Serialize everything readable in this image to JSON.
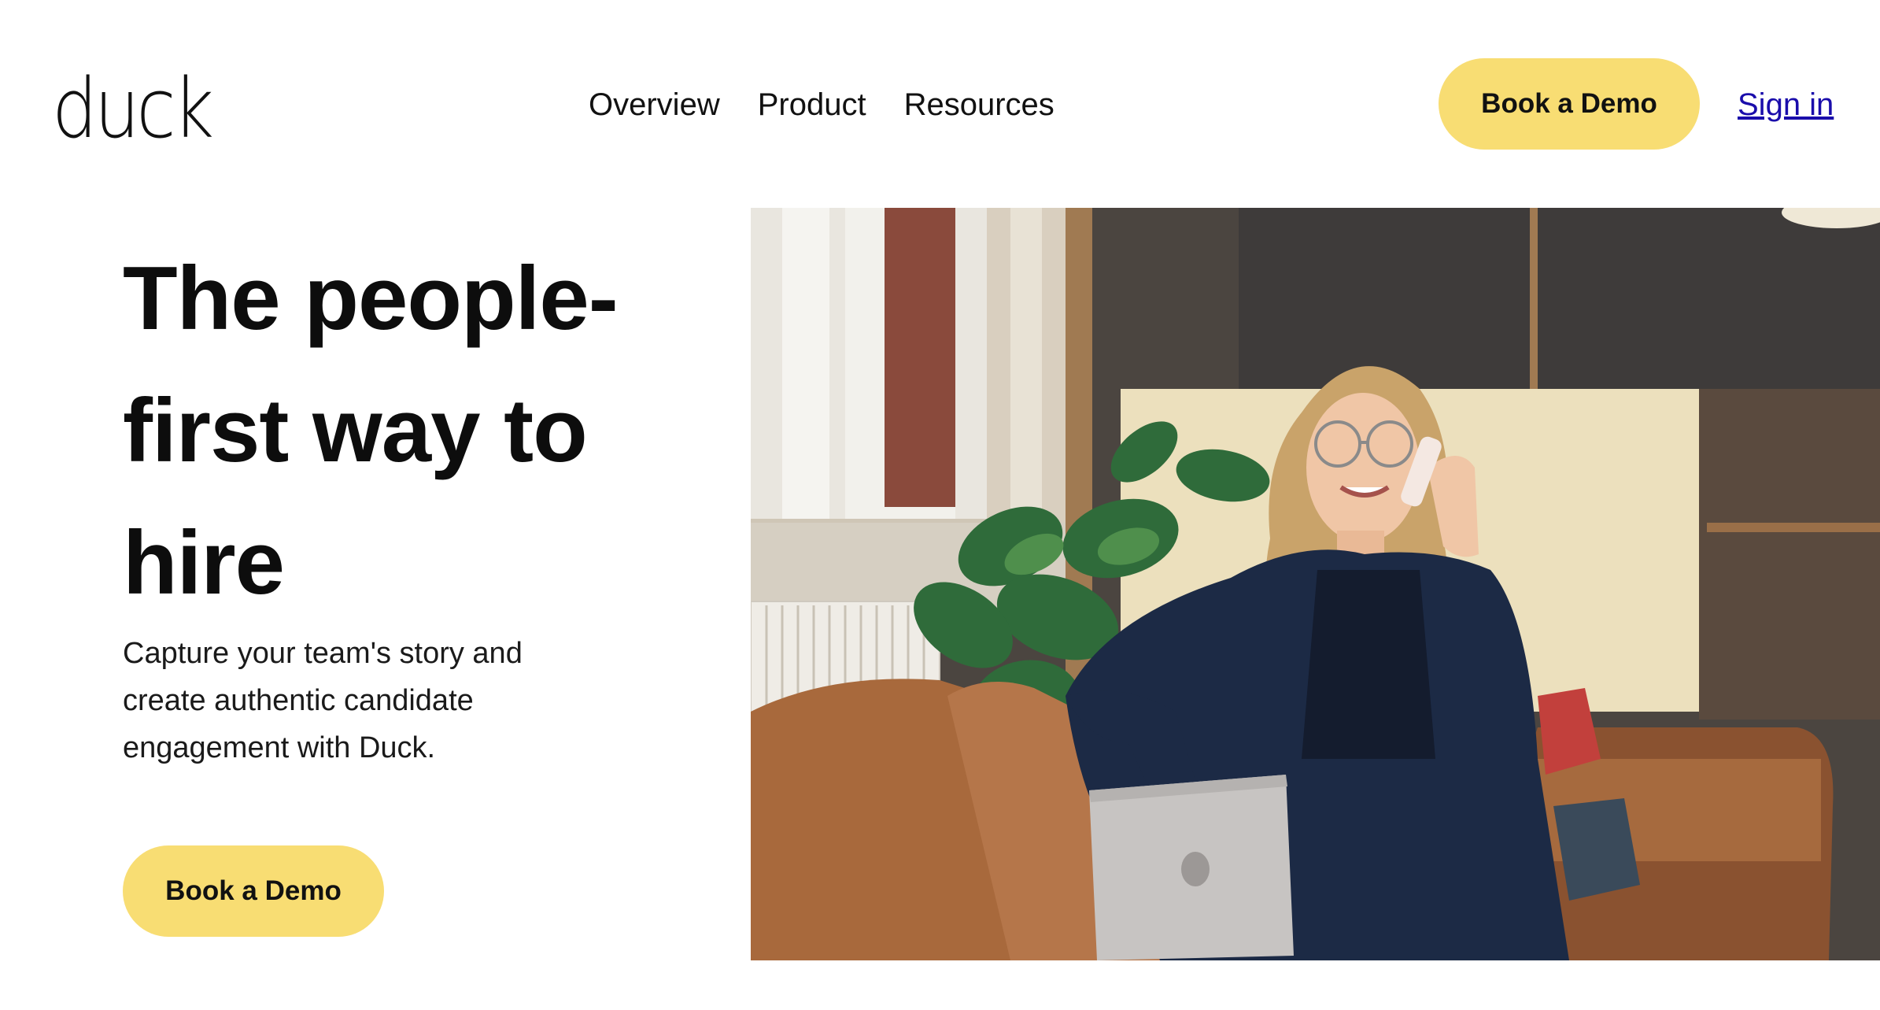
{
  "header": {
    "logo_text": "duck",
    "nav": [
      "Overview",
      "Product",
      "Resources"
    ],
    "cta_label": "Book a Demo",
    "signin_label": "Sign in"
  },
  "hero": {
    "title": "The people-first way to hire",
    "subtitle": "Capture your team's story and create authentic candidate engagement with Duck.",
    "cta_label": "Book a Demo"
  },
  "colors": {
    "accent": "#f8dd73",
    "link": "#1a0dab",
    "text": "#111111",
    "background": "#ffffff"
  }
}
